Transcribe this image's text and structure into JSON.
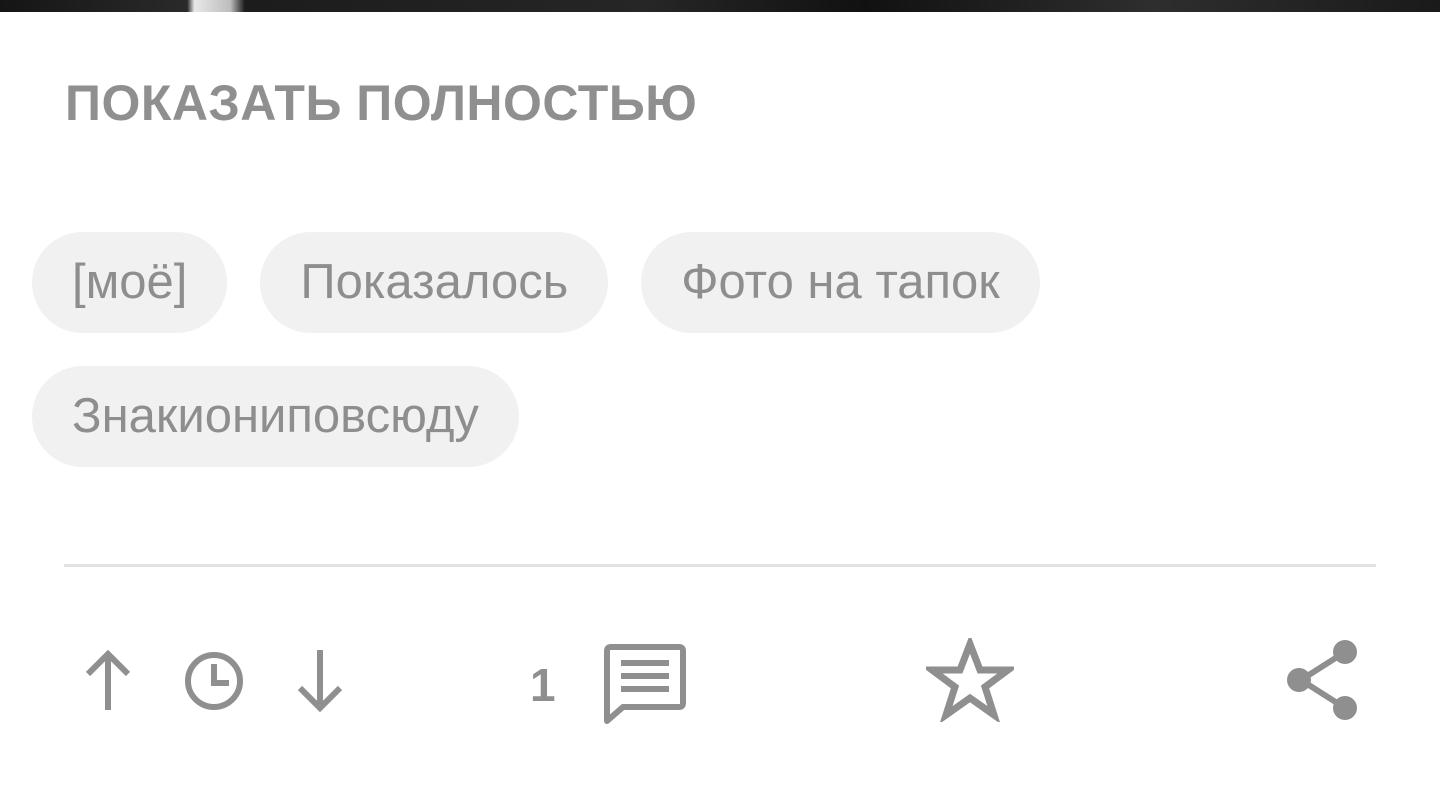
{
  "post": {
    "show_full_label": "ПОКАЗАТЬ ПОЛНОСТЬЮ",
    "tags": [
      [
        "[моё]",
        "Показалось",
        "Фото на тапок"
      ],
      [
        "Знакиониповсюду"
      ]
    ]
  },
  "actions": {
    "comment_count": "1",
    "icons": {
      "upvote": "arrow-up-icon",
      "history": "clock-icon",
      "downvote": "arrow-down-icon",
      "comments": "comment-icon",
      "favorite": "star-icon",
      "share": "share-icon"
    }
  },
  "colors": {
    "text_muted": "#8f8f8f",
    "tag_bg": "#f1f1f1",
    "divider": "#e2e2e2"
  }
}
